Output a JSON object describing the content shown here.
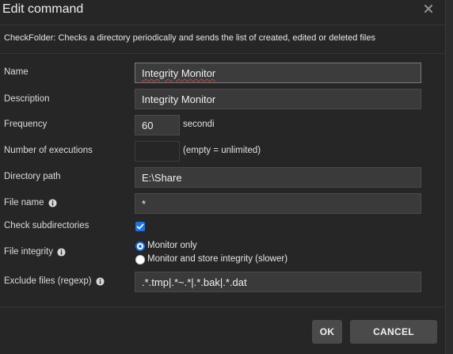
{
  "dialog": {
    "title": "Edit command",
    "description": "CheckFolder: Checks a directory periodically and sends the list of created, edited or deleted files"
  },
  "fields": {
    "name": {
      "label": "Name",
      "value": "Integrity Monitor"
    },
    "description": {
      "label": "Description",
      "value": "Integrity Monitor"
    },
    "frequency": {
      "label": "Frequency",
      "value": "60",
      "unit": "secondi"
    },
    "executions": {
      "label": "Number of executions",
      "value": "",
      "hint": "(empty = unlimited)"
    },
    "directory": {
      "label": "Directory path",
      "value": "E:\\Share"
    },
    "file_name": {
      "label": "File name",
      "value": "*"
    },
    "subdirs": {
      "label": "Check subdirectories",
      "checked": true
    },
    "integrity": {
      "label": "File integrity",
      "options": [
        "Monitor only",
        "Monitor and store integrity (slower)"
      ],
      "selected": "Monitor only"
    },
    "exclude": {
      "label": "Exclude files (regexp)",
      "value": ".*.tmp|.*~.*|.*.bak|.*.dat"
    }
  },
  "buttons": {
    "ok": "OK",
    "cancel": "CANCEL"
  },
  "colors": {
    "accent": "#1a73e8",
    "background": "#262626",
    "input": "#3a3a3a"
  },
  "icons": [
    "close-icon",
    "info-icon",
    "check-icon"
  ]
}
